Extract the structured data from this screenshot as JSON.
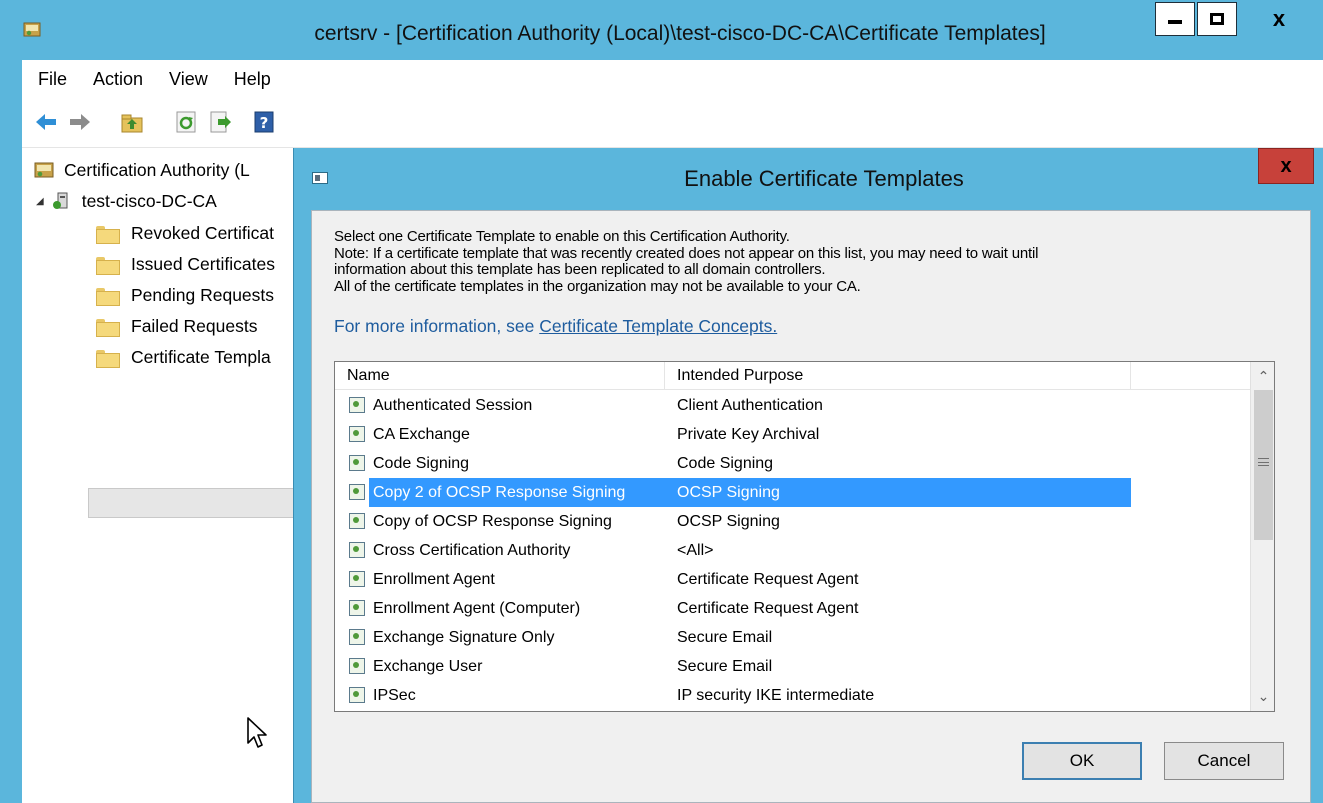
{
  "window": {
    "title": "certsrv - [Certification Authority (Local)\\test-cisco-DC-CA\\Certificate Templates]",
    "icon": "certsrv-app-icon",
    "minimize_icon": "minimize-icon",
    "maximize_icon": "maximize-icon",
    "close_label": "x"
  },
  "menubar": {
    "items": [
      "File",
      "Action",
      "View",
      "Help"
    ]
  },
  "toolbar": {
    "icons": [
      "back-arrow-icon",
      "forward-arrow-icon",
      "up-folder-icon",
      "refresh-icon",
      "export-list-icon",
      "help-icon"
    ]
  },
  "tree": {
    "root": "Certification Authority (L",
    "ca": "test-cisco-DC-CA",
    "expand_glyph": "◢",
    "items": [
      "Revoked Certificat",
      "Issued Certificates",
      "Pending Requests",
      "Failed Requests",
      "Certificate Templa"
    ],
    "selected_index": 4
  },
  "dialog": {
    "title": "Enable Certificate Templates",
    "close_label": "x",
    "intro_lines": [
      "Select one Certificate Template to enable on this Certification Authority.",
      "Note: If a certificate template that was recently created does not appear on this list, you may need to wait until",
      "information about this template has been replicated to all domain controllers.",
      "All of the certificate templates in the organization may not be available to your CA."
    ],
    "more_info_prefix": "For more information, see ",
    "more_info_link": "Certificate Template Concepts.",
    "columns": [
      "Name",
      "Intended Purpose"
    ],
    "rows": [
      {
        "name": "Authenticated Session",
        "purpose": "Client Authentication"
      },
      {
        "name": "CA Exchange",
        "purpose": "Private Key Archival"
      },
      {
        "name": "Code Signing",
        "purpose": "Code Signing"
      },
      {
        "name": "Copy 2 of OCSP Response Signing",
        "purpose": "OCSP Signing"
      },
      {
        "name": "Copy of OCSP Response Signing",
        "purpose": "OCSP Signing"
      },
      {
        "name": "Cross Certification Authority",
        "purpose": "<All>"
      },
      {
        "name": "Enrollment Agent",
        "purpose": "Certificate Request Agent"
      },
      {
        "name": "Enrollment Agent (Computer)",
        "purpose": "Certificate Request Agent"
      },
      {
        "name": "Exchange Signature Only",
        "purpose": "Secure Email"
      },
      {
        "name": "Exchange User",
        "purpose": "Secure Email"
      },
      {
        "name": "IPSec",
        "purpose": "IP security IKE intermediate"
      }
    ],
    "selected_row": 3,
    "scroll_up": "⌃",
    "scroll_down": "⌄",
    "ok_label": "OK",
    "cancel_label": "Cancel"
  }
}
